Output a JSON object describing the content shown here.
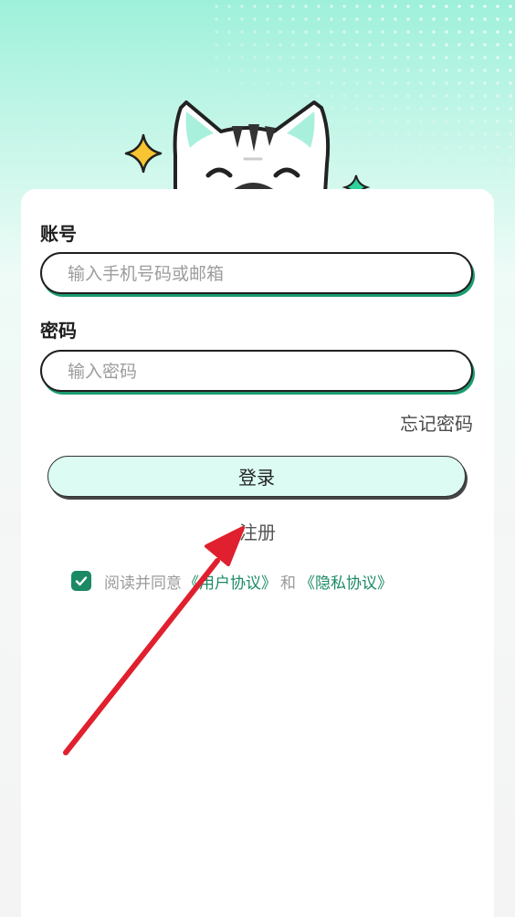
{
  "account": {
    "label": "账号",
    "placeholder": "输入手机号码或邮箱",
    "value": ""
  },
  "password": {
    "label": "密码",
    "placeholder": "输入密码",
    "value": ""
  },
  "forgot_password": "忘记密码",
  "login_button": "登录",
  "register_link": "注册",
  "agreement": {
    "checked": true,
    "prefix": "阅读并同意",
    "user_agreement": "《用户协议》",
    "and": "和",
    "privacy_agreement": "《隐私协议》"
  },
  "colors": {
    "accent": "#1b8a64",
    "field_shadow": "#1c9c72",
    "button_bg": "#dcfcf3",
    "annotation_arrow": "#e0202e"
  },
  "icons": [
    "sparkle-star-icon",
    "cat-mascot-icon",
    "checkmark-icon",
    "annotation-arrow-icon"
  ]
}
